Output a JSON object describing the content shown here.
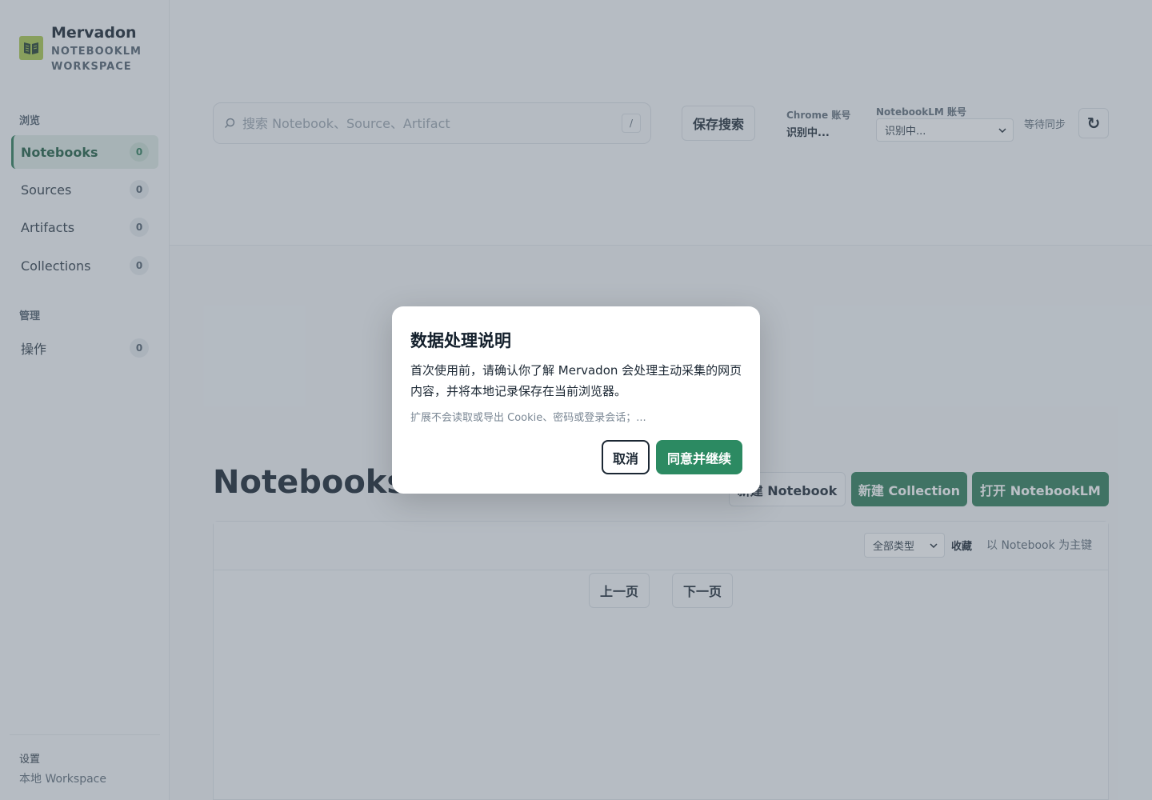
{
  "brand": {
    "name": "Mervadon",
    "sub_line1": "NOTEBOOKLM",
    "sub_line2": "WORKSPACE"
  },
  "sidebar": {
    "browse_label": "浏览",
    "items": [
      {
        "label": "Notebooks",
        "count": "0"
      },
      {
        "label": "Sources",
        "count": "0"
      },
      {
        "label": "Artifacts",
        "count": "0"
      },
      {
        "label": "Collections",
        "count": "0"
      }
    ],
    "manage_label": "管理",
    "manage_items": [
      {
        "label": "操作",
        "count": "0"
      }
    ],
    "settings_title": "设置",
    "settings_sub": "本地 Workspace"
  },
  "header": {
    "search_placeholder": "搜索 Notebook、Source、Artifact",
    "search_shortcut": "/",
    "save_search": "保存搜索",
    "chrome_account_label": "Chrome 账号",
    "chrome_account_value": "识别中...",
    "notebooklm_account_label": "NotebookLM 账号",
    "notebooklm_account_value": "识别中...",
    "sync_status": "等待同步",
    "refresh_glyph": "↻"
  },
  "main": {
    "title": "Notebooks",
    "new_notebook": "新建 Notebook",
    "new_collection": "新建 Collection",
    "open_notebooklm": "打开 NotebookLM",
    "filter_type": "全部类型",
    "filter_favorites": "收藏",
    "filter_primary": "以 Notebook 为主键",
    "prev_page": "上一页",
    "next_page": "下一页"
  },
  "dialog": {
    "title": "数据处理说明",
    "body": "首次使用前，请确认你了解 Mervadon 会处理主动采集的网页内容，并将本地记录保存在当前浏览器。",
    "note": "扩展不会读取或导出 Cookie、密码或登录会话；...",
    "cancel": "取消",
    "confirm": "同意并继续"
  },
  "colors": {
    "accent": "#2c7a57",
    "dialog_accent": "#2c8a62",
    "logo": "#a8c64b"
  }
}
